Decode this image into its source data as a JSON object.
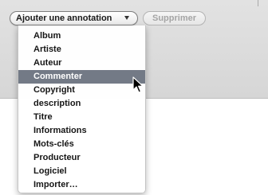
{
  "toolbar": {
    "annotation_popup_label": "Ajouter une annotation",
    "delete_label": "Supprimer"
  },
  "menu": {
    "items": [
      {
        "label": "Album"
      },
      {
        "label": "Artiste"
      },
      {
        "label": "Auteur"
      },
      {
        "label": "Commenter",
        "highlighted": true
      },
      {
        "label": "Copyright"
      },
      {
        "label": "description"
      },
      {
        "label": "Titre"
      },
      {
        "label": "Informations"
      },
      {
        "label": "Mots-clés"
      },
      {
        "label": "Producteur"
      },
      {
        "label": "Logiciel"
      },
      {
        "label": "Importer…"
      }
    ]
  },
  "icons": {
    "popup_arrow": "chevron-down-icon",
    "cursor": "mouse-pointer-icon"
  },
  "colors": {
    "highlight": "#737a86",
    "panel": "#dcdcdc"
  }
}
